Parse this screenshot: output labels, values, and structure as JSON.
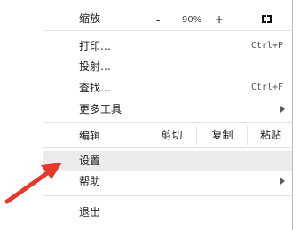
{
  "menu": {
    "zoom": {
      "label": "缩放",
      "minus": "-",
      "value": "90%",
      "plus": "+"
    },
    "print": {
      "label": "打印…",
      "shortcut": "Ctrl+P"
    },
    "cast": {
      "label": "投射…"
    },
    "find": {
      "label": "查找…",
      "shortcut": "Ctrl+F"
    },
    "more_tools": {
      "label": "更多工具"
    },
    "edit": {
      "label": "编辑",
      "cut": "剪切",
      "copy": "复制",
      "paste": "粘贴"
    },
    "settings": {
      "label": "设置"
    },
    "help": {
      "label": "帮助"
    },
    "exit": {
      "label": "退出"
    }
  },
  "colors": {
    "highlight": "#ececec",
    "pointer_arrow": "#e6392b"
  },
  "icons": {
    "fullscreen": "fullscreen-icon",
    "submenu": "chevron-right-icon",
    "annotation": "red-arrow-icon"
  }
}
